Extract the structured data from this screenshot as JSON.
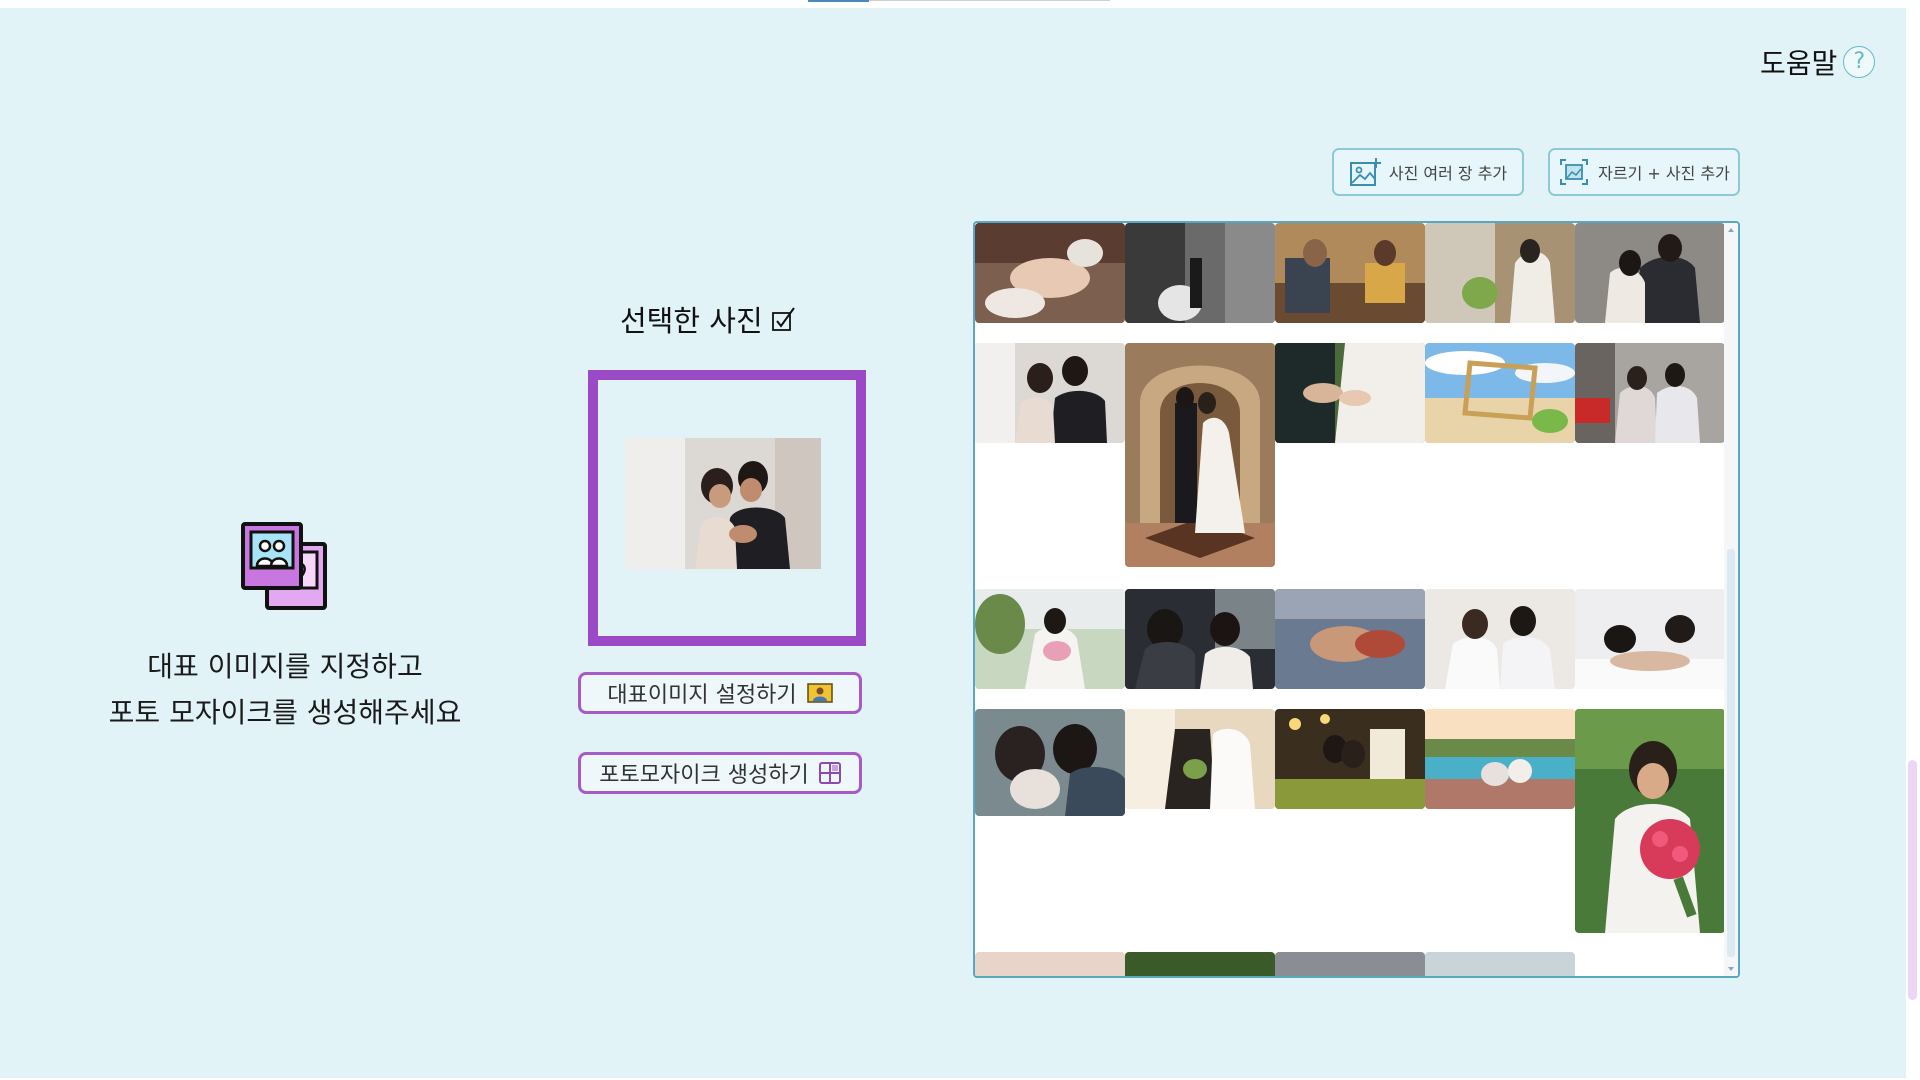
{
  "help": {
    "label": "도움말",
    "icon": "question-circle-icon"
  },
  "intro": {
    "icon": "photo-stack-icon",
    "line1": "대표 이미지를 지정하고",
    "line2": "포토 모자이크를 생성해주세요"
  },
  "selected": {
    "title": "선택한 사진",
    "title_icon": "checkbox-icon"
  },
  "buttons": {
    "set_main": "대표이미지 설정하기",
    "make_mosaic": "포토모자이크 생성하기",
    "add_many": "사진 여러 장 추가",
    "crop_add": "자르기 + 사진 추가"
  },
  "colors": {
    "background": "#e2f3f7",
    "accent_purple": "#9b4ac6",
    "button_border_purple": "#a55cc9",
    "gallery_border": "#5aa8c0",
    "tab_indicator": "#4a8ac0"
  },
  "gallery": {
    "items": [
      {
        "name": "photo-hands-rings-bouquet"
      },
      {
        "name": "photo-bw-couple-garden"
      },
      {
        "name": "photo-couple-cafe"
      },
      {
        "name": "photo-bride-window"
      },
      {
        "name": "photo-couple-embrace-suit"
      },
      {
        "name": "photo-couple-ring-show"
      },
      {
        "name": "photo-couple-kiss-hall"
      },
      {
        "name": "photo-hands-holding"
      },
      {
        "name": "photo-beach-frame"
      },
      {
        "name": "photo-couple-street"
      },
      {
        "name": "photo-bride-bouquet-garden"
      },
      {
        "name": "photo-couple-dining"
      },
      {
        "name": "photo-hands-henna"
      },
      {
        "name": "photo-couple-white-tees"
      },
      {
        "name": "photo-couple-bed"
      },
      {
        "name": "photo-couple-kiss-closeup"
      },
      {
        "name": "photo-couple-outdoor-bouquet"
      },
      {
        "name": "photo-wedding-cake-lights"
      },
      {
        "name": "photo-pool-sunset"
      },
      {
        "name": "photo-bride-red-roses"
      }
    ]
  }
}
